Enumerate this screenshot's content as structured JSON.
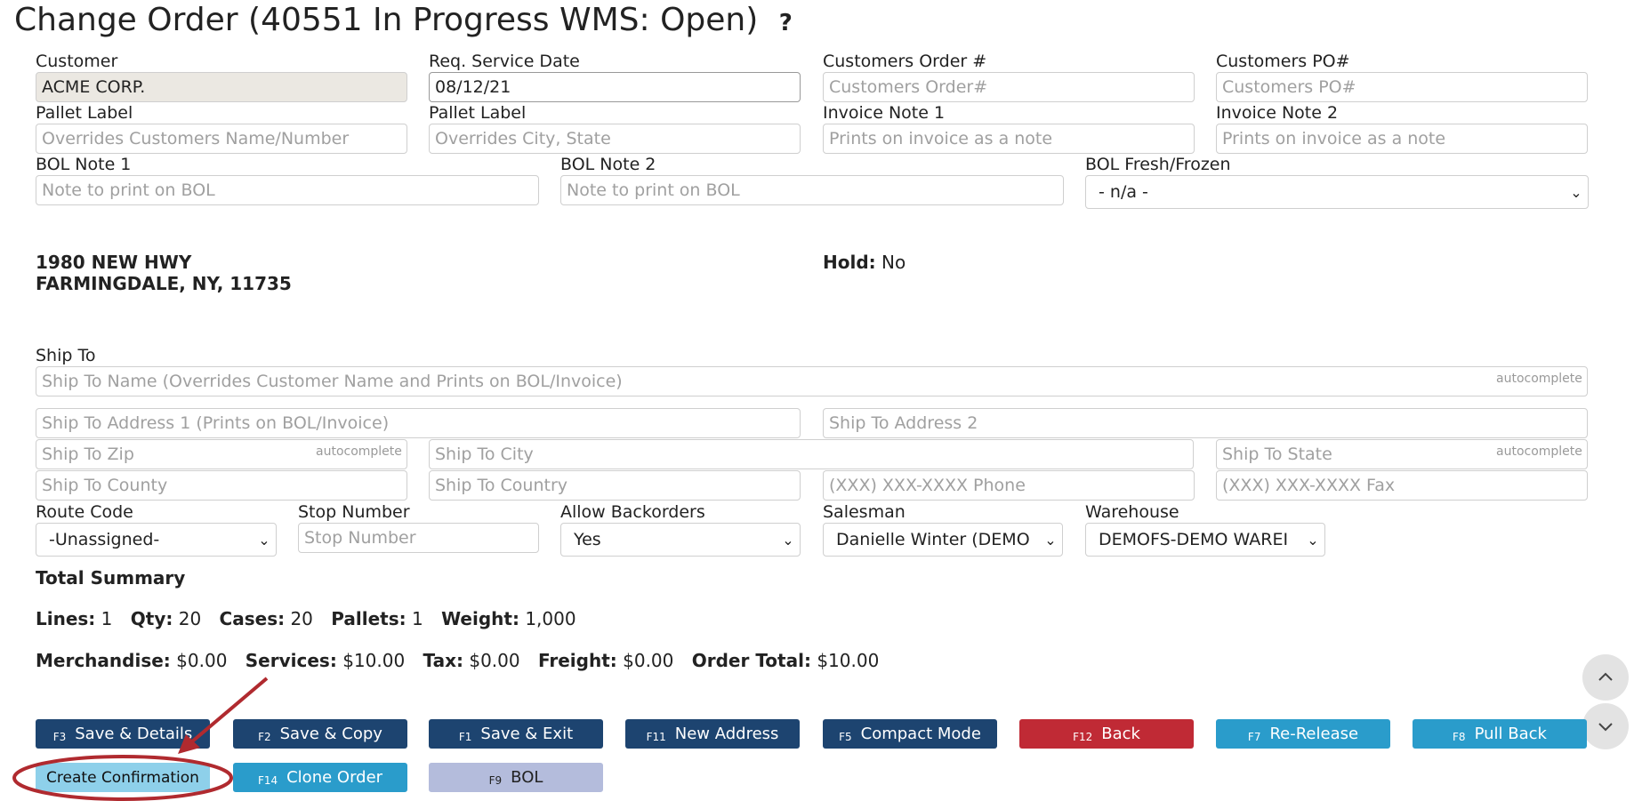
{
  "title": {
    "text": "Change Order (40551 In Progress WMS: Open)",
    "help": "?"
  },
  "fields": {
    "customer": {
      "label": "Customer",
      "value": "ACME CORP."
    },
    "req_service_date": {
      "label": "Req. Service Date",
      "value": "08/12/21"
    },
    "customers_order": {
      "label": "Customers Order #",
      "placeholder": "Customers Order#"
    },
    "customers_po": {
      "label": "Customers PO#",
      "placeholder": "Customers PO#"
    },
    "pallet_label_1": {
      "label": "Pallet Label",
      "placeholder": "Overrides Customers Name/Number"
    },
    "pallet_label_2": {
      "label": "Pallet Label",
      "placeholder": "Overrides City, State"
    },
    "invoice_note_1": {
      "label": "Invoice Note 1",
      "placeholder": "Prints on invoice as a note"
    },
    "invoice_note_2": {
      "label": "Invoice Note 2",
      "placeholder": "Prints on invoice as a note"
    },
    "bol_note_1": {
      "label": "BOL Note 1",
      "placeholder": "Note to print on BOL"
    },
    "bol_note_2": {
      "label": "BOL Note 2",
      "placeholder": "Note to print on BOL"
    },
    "bol_fresh_frozen": {
      "label": "BOL Fresh/Frozen",
      "value": "- n/a -"
    }
  },
  "address": {
    "line1": "1980 NEW HWY",
    "line2": "FARMINGDALE, NY, 11735"
  },
  "hold": {
    "label": "Hold:",
    "value": "No"
  },
  "ship_to": {
    "label": "Ship To",
    "autocomplete": "autocomplete",
    "name_placeholder": "Ship To Name (Overrides Customer Name and Prints on BOL/Invoice)",
    "address1_placeholder": "Ship To Address 1 (Prints on BOL/Invoice)",
    "address2_placeholder": "Ship To Address 2",
    "zip_placeholder": "Ship To Zip",
    "city_placeholder": "Ship To City",
    "state_placeholder": "Ship To State",
    "county_placeholder": "Ship To County",
    "country_placeholder": "Ship To Country",
    "phone_placeholder": "(XXX) XXX-XXXX Phone",
    "fax_placeholder": "(XXX) XXX-XXXX Fax"
  },
  "routing": {
    "route_code": {
      "label": "Route Code",
      "value": "-Unassigned-"
    },
    "stop_number": {
      "label": "Stop Number",
      "placeholder": "Stop Number"
    },
    "allow_backorders": {
      "label": "Allow Backorders",
      "value": "Yes"
    },
    "salesman": {
      "label": "Salesman",
      "value": "Danielle Winter (DEMO"
    },
    "warehouse": {
      "label": "Warehouse",
      "value": "DEMOFS-DEMO WAREI"
    }
  },
  "summary": {
    "title": "Total Summary",
    "lines_label": "Lines:",
    "lines": "1",
    "qty_label": "Qty:",
    "qty": "20",
    "cases_label": "Cases:",
    "cases": "20",
    "pallets_label": "Pallets:",
    "pallets": "1",
    "weight_label": "Weight:",
    "weight": "1,000",
    "merch_label": "Merchandise:",
    "merch": "$0.00",
    "services_label": "Services:",
    "services": "$10.00",
    "tax_label": "Tax:",
    "tax": "$0.00",
    "freight_label": "Freight:",
    "freight": "$0.00",
    "total_label": "Order Total:",
    "total": "$10.00"
  },
  "buttons": {
    "save_details": {
      "key": "F3",
      "label": "Save & Details"
    },
    "save_copy": {
      "key": "F2",
      "label": "Save & Copy"
    },
    "save_exit": {
      "key": "F1",
      "label": "Save & Exit"
    },
    "new_address": {
      "key": "F11",
      "label": "New Address"
    },
    "compact_mode": {
      "key": "F5",
      "label": "Compact Mode"
    },
    "back": {
      "key": "F12",
      "label": "Back"
    },
    "re_release": {
      "key": "F7",
      "label": "Re-Release"
    },
    "pull_back": {
      "key": "F8",
      "label": "Pull Back"
    },
    "create_confirmation": {
      "label": "Create Confirmation"
    },
    "clone_order": {
      "key": "F14",
      "label": "Clone Order"
    },
    "bol": {
      "key": "F9",
      "label": "BOL"
    }
  },
  "icons": {
    "scroll_up": "chevron-up-icon",
    "scroll_down": "chevron-down-icon"
  },
  "colors": {
    "navy": "#1d4470",
    "red": "#c02a35",
    "teal": "#2a9ccb",
    "lavender": "#b4bcdc",
    "annotation": "#b02a2f"
  }
}
